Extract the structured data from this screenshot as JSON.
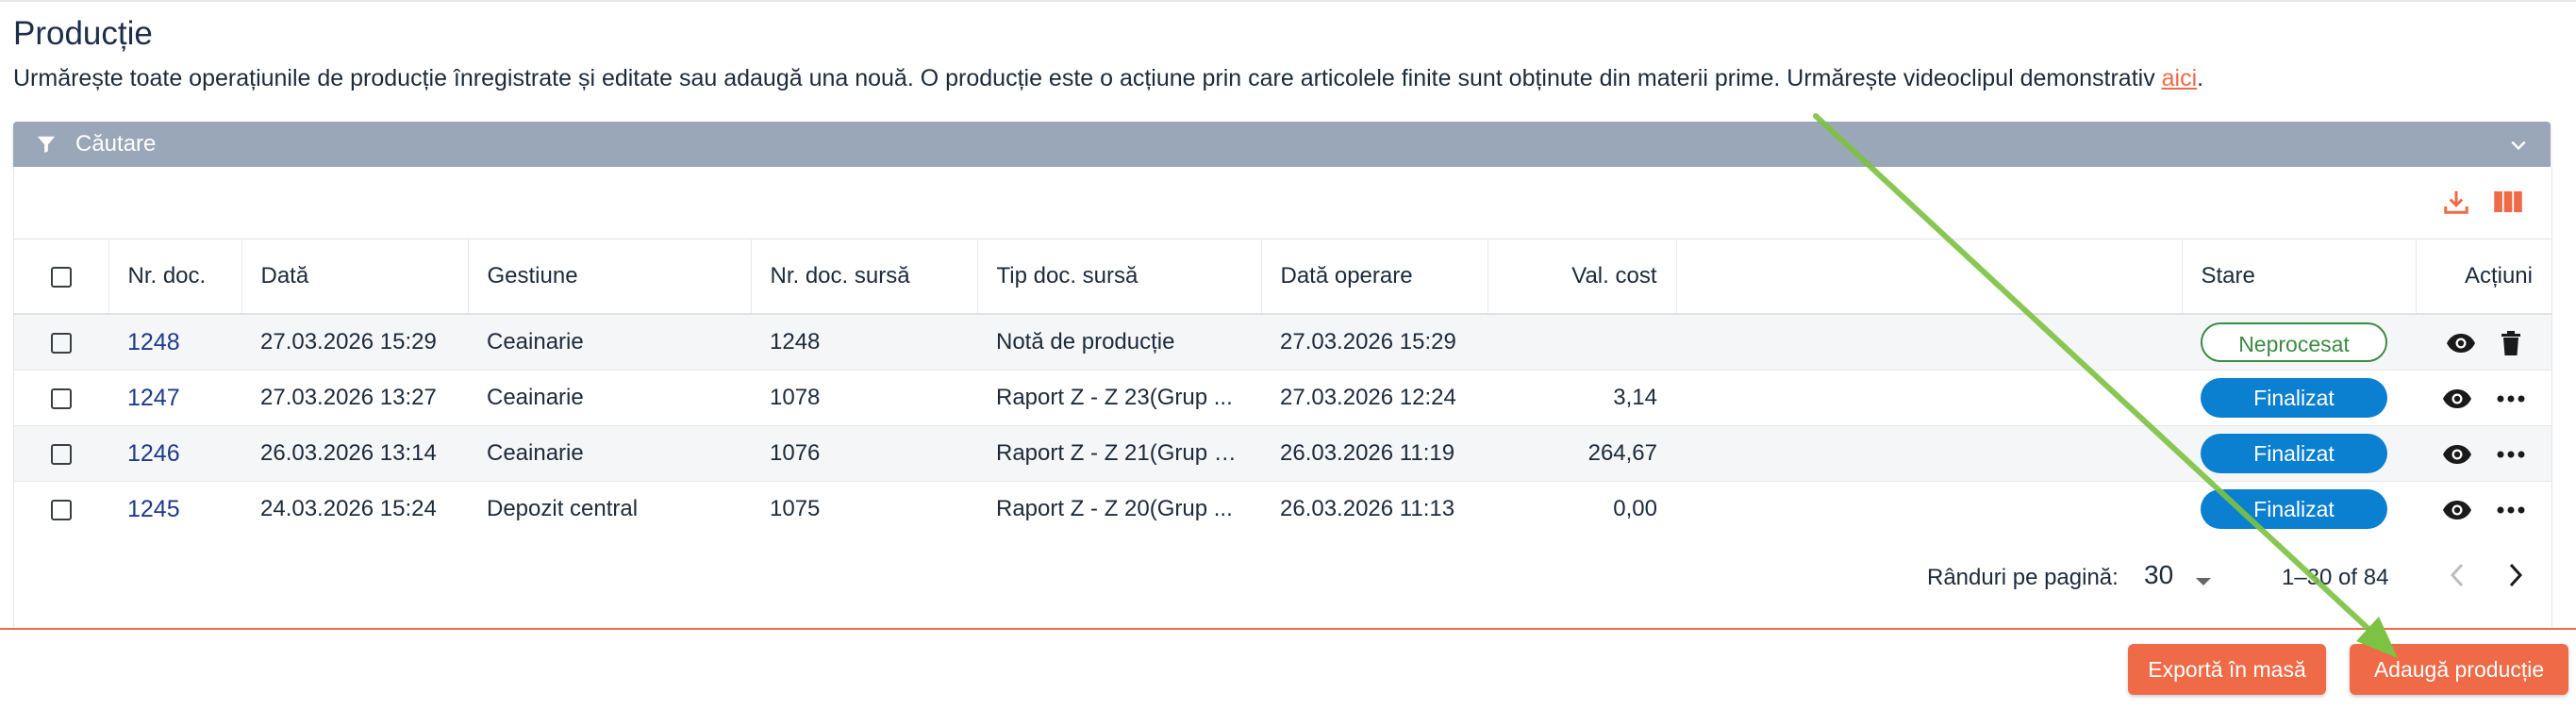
{
  "page": {
    "title": "Producție",
    "description_prefix": "Urmărește toate operațiunile de producție înregistrate și editate sau adaugă una nouă. O producție este o acțiune prin care articolele finite sunt obținute din materii prime. Urmărește videoclipul demonstrativ ",
    "description_link": "aici",
    "description_suffix": "."
  },
  "filter": {
    "label": "Căutare",
    "icon": "filter-icon"
  },
  "toolbar": {
    "download_icon": "download-icon",
    "columns_icon": "columns-icon",
    "accent": "#ef6a47"
  },
  "table": {
    "headers": {
      "nr_doc": "Nr. doc.",
      "data": "Dată",
      "gestiune": "Gestiune",
      "nr_doc_sursa": "Nr. doc. sursă",
      "tip_doc_sursa": "Tip doc. sursă",
      "data_operare": "Dată operare",
      "val_cost": "Val. cost",
      "stare": "Stare",
      "actiuni": "Acțiuni"
    },
    "rows": [
      {
        "nr_doc": "1248",
        "data": "27.03.2026 15:29",
        "gestiune": "Ceainarie",
        "nr_doc_sursa": "1248",
        "tip_doc_sursa": "Notă de producție",
        "data_operare": "27.03.2026 15:29",
        "val_cost": "",
        "stare": "Neprocesat"
      },
      {
        "nr_doc": "1247",
        "data": "27.03.2026 13:27",
        "gestiune": "Ceainarie",
        "nr_doc_sursa": "1078",
        "tip_doc_sursa": "Raport Z - Z 23(Grup ...",
        "data_operare": "27.03.2026 12:24",
        "val_cost": "3,14",
        "stare": "Finalizat"
      },
      {
        "nr_doc": "1246",
        "data": "26.03.2026 13:14",
        "gestiune": "Ceainarie",
        "nr_doc_sursa": "1076",
        "tip_doc_sursa": "Raport Z - Z 21(Grup P...",
        "data_operare": "26.03.2026 11:19",
        "val_cost": "264,67",
        "stare": "Finalizat"
      },
      {
        "nr_doc": "1245",
        "data": "24.03.2026 15:24",
        "gestiune": "Depozit central",
        "nr_doc_sursa": "1075",
        "tip_doc_sursa": "Raport Z - Z 20(Grup ...",
        "data_operare": "26.03.2026 11:13",
        "val_cost": "0,00",
        "stare": "Finalizat"
      }
    ],
    "status_colors": {
      "Neprocesat": "#3d8a43",
      "Finalizat": "#0b7fd0"
    }
  },
  "pagination": {
    "rows_label": "Rânduri pe pagină:",
    "rows_value": "30",
    "range": "1–30 of 84"
  },
  "footer": {
    "export_label": "Exportă în masă",
    "add_label": "Adaugă producție"
  },
  "colors": {
    "accent": "#ef6a47",
    "filter_bar": "#9aa7b8",
    "annotation_arrow": "#7dc242"
  }
}
